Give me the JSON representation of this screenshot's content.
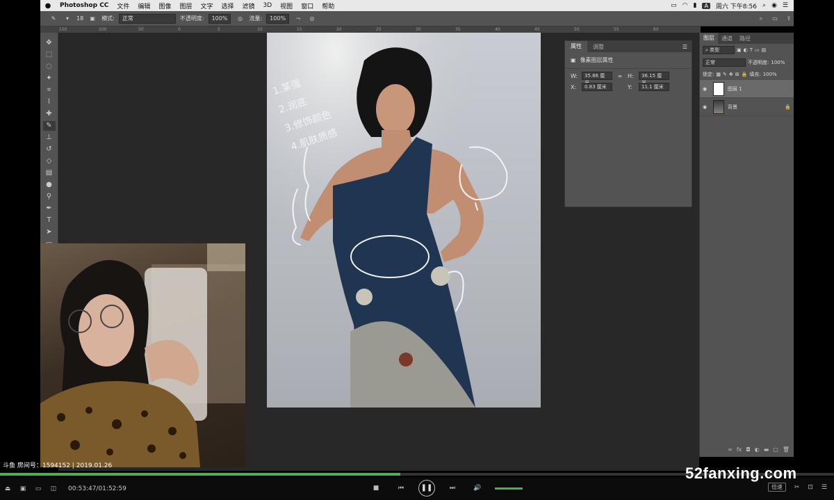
{
  "menubar": {
    "apple": "",
    "app_name": "Photoshop CC",
    "items": [
      "文件",
      "编辑",
      "图像",
      "图层",
      "文字",
      "选择",
      "滤镜",
      "3D",
      "视图",
      "窗口",
      "帮助"
    ],
    "input_badge": "A",
    "clock": "周六 下午8:56"
  },
  "options_bar": {
    "brush_size": "18",
    "mode_label": "模式:",
    "mode_value": "正常",
    "opacity_label": "不透明度:",
    "opacity_value": "100%",
    "flow_label": "流量:",
    "flow_value": "100%"
  },
  "ruler": {
    "ticks": [
      "150",
      "100",
      "50",
      "0",
      "5",
      "10",
      "15",
      "20",
      "25",
      "30",
      "35",
      "40",
      "45",
      "50",
      "55",
      "60"
    ]
  },
  "properties_panel": {
    "tabs": [
      "属性",
      "调整"
    ],
    "header": "像素图层属性",
    "w_label": "W:",
    "w_value": "35.86 厘米",
    "h_label": "H:",
    "h_value": "36.15 厘米",
    "x_label": "X:",
    "x_value": "0.83 厘米",
    "y_label": "Y:",
    "y_value": "11.1 厘米"
  },
  "layers_panel": {
    "tabs": [
      "图层",
      "通道",
      "路径"
    ],
    "filter_label": "类型",
    "blend_mode": "正常",
    "opacity_label": "不透明度:",
    "opacity_value": "100%",
    "lock_label": "锁定:",
    "fill_label": "填充:",
    "fill_value": "100%",
    "layers": [
      {
        "name": "图层 1",
        "selected": true
      },
      {
        "name": "背景",
        "selected": false
      }
    ]
  },
  "annotation": {
    "lines": [
      "1.某强",
      "2.润底",
      "3.修饰颜色",
      "4.肌肤质感"
    ]
  },
  "stream": {
    "room_info": "斗鱼 房间号：1594152 | 2019.01.26"
  },
  "player": {
    "time": "00:53:47/01:52:59",
    "progress_fraction": 0.48,
    "speed_label": "倍速"
  },
  "watermark": "52fanxing.com",
  "colors": {
    "ps_panel": "#535353",
    "ps_workspace": "#282828",
    "progress_green": "#4caf50"
  }
}
